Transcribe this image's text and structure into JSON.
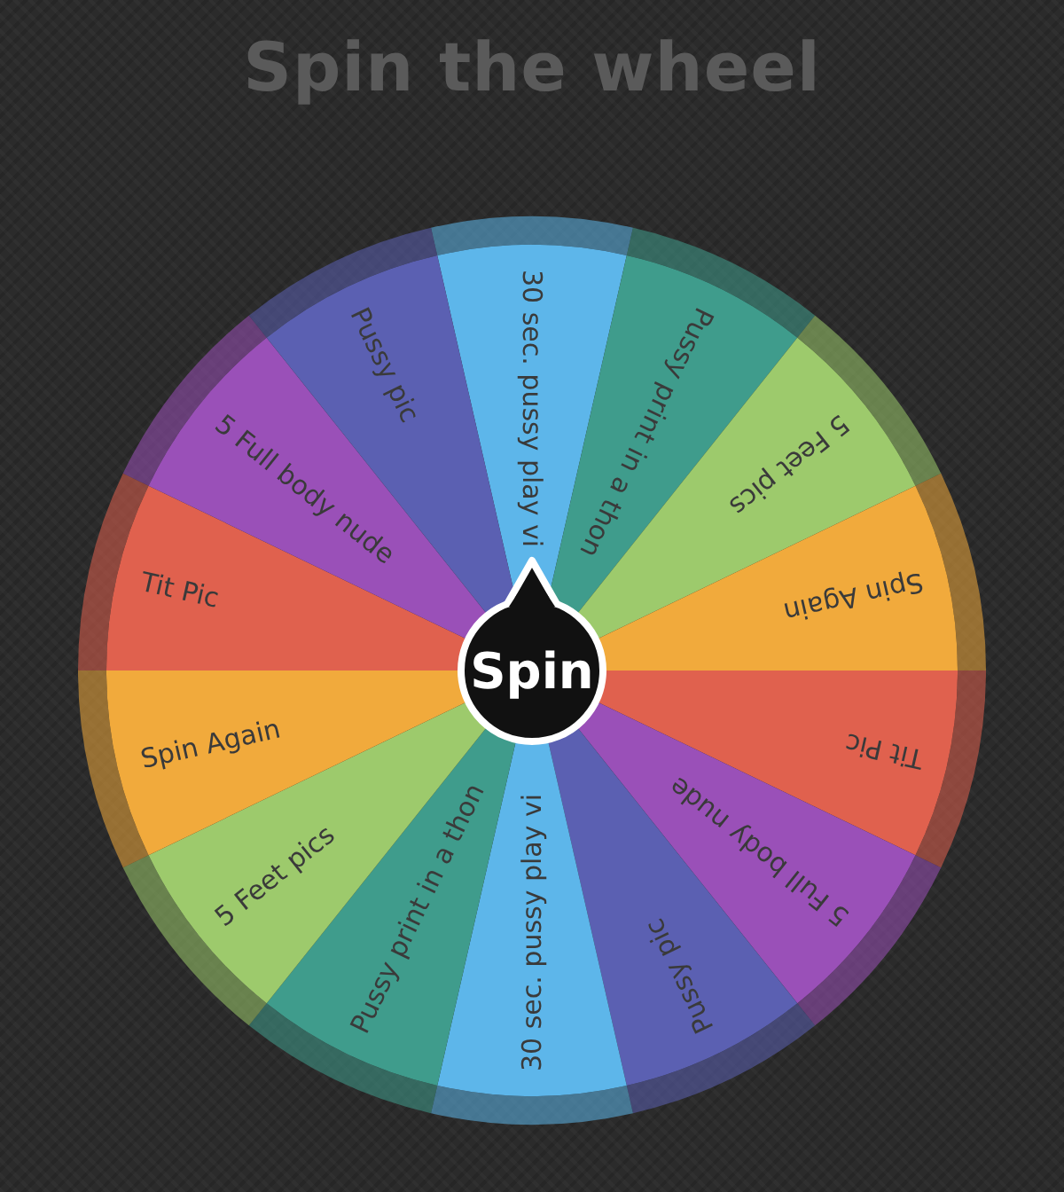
{
  "title": "Spin the wheel",
  "spin_button": {
    "label": "Spin"
  },
  "segments": [
    {
      "label": "30 sec. pussy play vi",
      "color": "#5db6ea"
    },
    {
      "label": "Pussy print in a thon",
      "color": "#3f9c8c"
    },
    {
      "label": "5 Feet pics",
      "color": "#9dca6c"
    },
    {
      "label": "Spin Again",
      "color": "#f1aa3c"
    },
    {
      "label": "Tit Pic",
      "color": "#e0614e"
    },
    {
      "label": "5 Full body nude",
      "color": "#9a50b8"
    },
    {
      "label": "Pussy pic",
      "color": "#5b60b2"
    },
    {
      "label": "30 sec. pussy play vi",
      "color": "#5db6ea"
    },
    {
      "label": "Pussy print in a thon",
      "color": "#3f9c8c"
    },
    {
      "label": "5 Feet pics",
      "color": "#9dca6c"
    },
    {
      "label": "Spin Again",
      "color": "#f1aa3c"
    },
    {
      "label": "Tit Pic",
      "color": "#e0614e"
    },
    {
      "label": "5 Full body nude",
      "color": "#9a50b8"
    },
    {
      "label": "Pussy pic",
      "color": "#5b60b2"
    }
  ]
}
